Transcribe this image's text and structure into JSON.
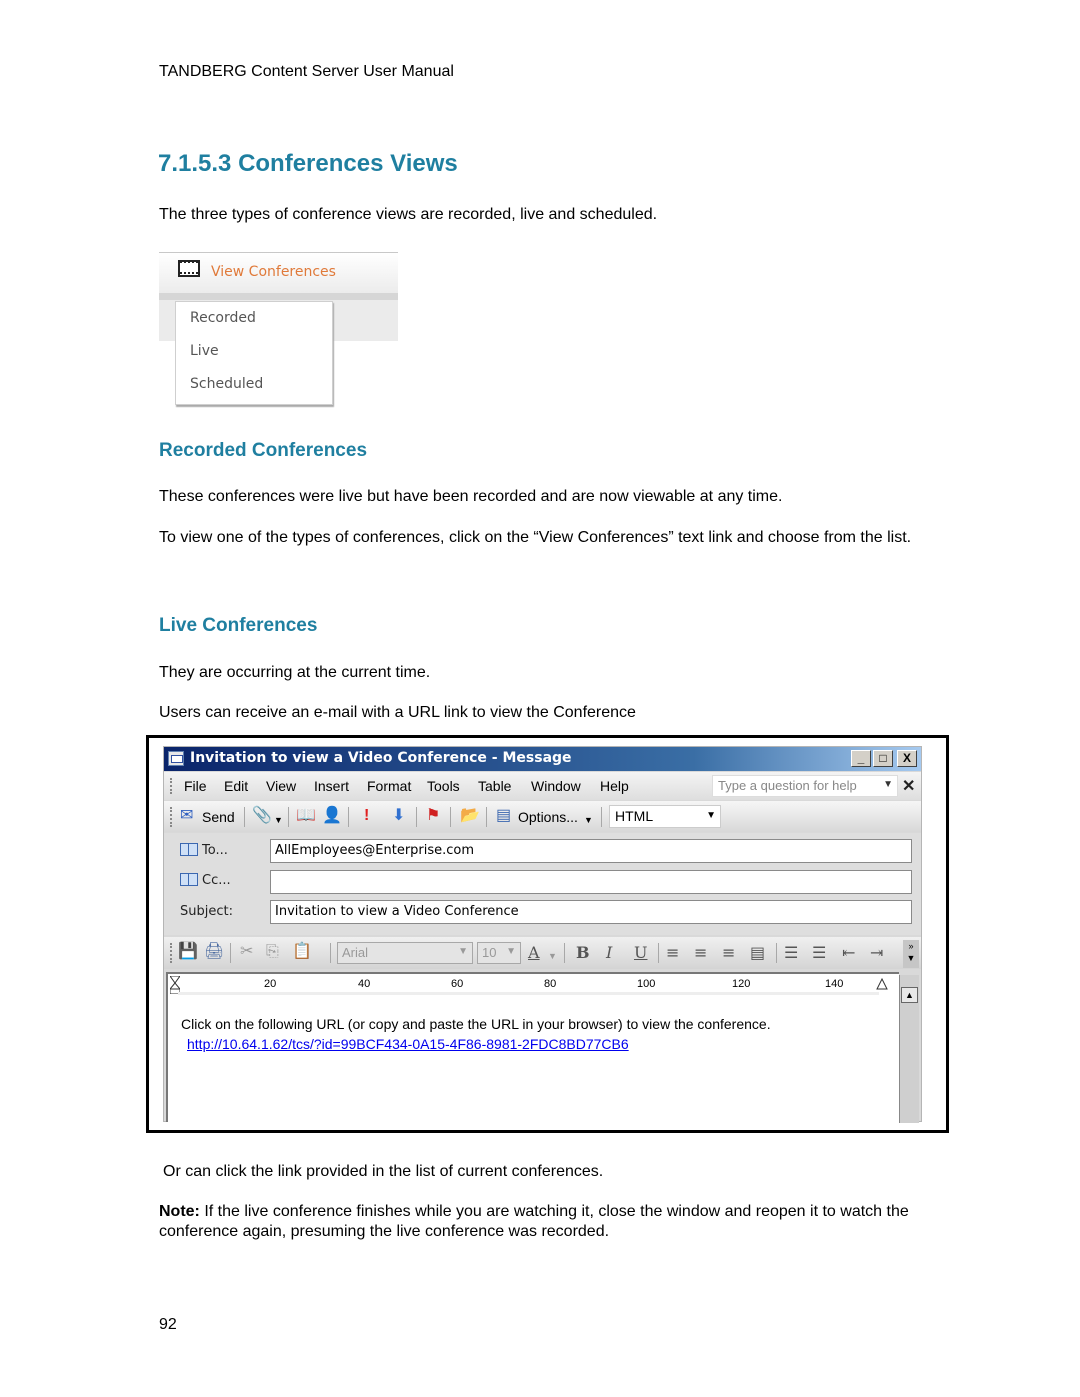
{
  "running_header": "TANDBERG Content Server User Manual",
  "section": {
    "title": "7.1.5.3 Conferences Views",
    "intro": "The three types of conference views are recorded, live and scheduled."
  },
  "view_conferences_widget": {
    "icon": "film-icon",
    "link_label": "View Conferences",
    "link_color": "#e07a3a",
    "menu_items": [
      "Recorded",
      "Live",
      "Scheduled"
    ]
  },
  "recorded": {
    "heading": "Recorded Conferences",
    "paragraphs": [
      "These conferences were live but have been recorded and are now viewable at any time.",
      "To view one of the types of conferences, click on the “View Conferences” text link and choose from the list."
    ]
  },
  "live": {
    "heading": "Live Conferences",
    "paragraphs": [
      "They are occurring at the current time.",
      "Users can receive an e-mail with a URL link to view the Conference"
    ]
  },
  "email_window": {
    "title": "Invitation to view a Video Conference - Message",
    "window_buttons": [
      "_",
      "□",
      "X"
    ],
    "menu": [
      "File",
      "Edit",
      "View",
      "Insert",
      "Format",
      "Tools",
      "Table",
      "Window",
      "Help"
    ],
    "help_placeholder": "Type a question for help",
    "toolbar": {
      "send_label": "Send",
      "options_label": "Options...",
      "format_value": "HTML"
    },
    "fields": {
      "to_label": "To...",
      "to_value": "AllEmployees@Enterprise.com",
      "cc_label": "Cc...",
      "cc_value": "",
      "subject_label": "Subject:",
      "subject_value": "Invitation to view a Video Conference"
    },
    "formatting": {
      "font_name": "Arial",
      "font_size": "10"
    },
    "ruler_numbers": [
      "20",
      "40",
      "60",
      "80",
      "100",
      "120",
      "140"
    ],
    "body": {
      "text": "Click on the following URL (or copy and paste the URL in your browser) to view the conference.",
      "link": "http://10.64.1.62/tcs/?id=99BCF434-0A15-4F86-8981-2FDC8BD77CB6",
      "link_color": "#0000ee"
    }
  },
  "after": {
    "paragraph": "Or can click the link provided in the list of current conferences.",
    "note_label": "Note:",
    "note_text": "If the live conference finishes while you are watching it, close the window and reopen it to watch the conference again, presuming the live conference was recorded."
  },
  "page_number": "92",
  "colors": {
    "heading": "#1f7fa0",
    "titlebar_start": "#0a246a",
    "titlebar_end": "#a6caf0"
  }
}
